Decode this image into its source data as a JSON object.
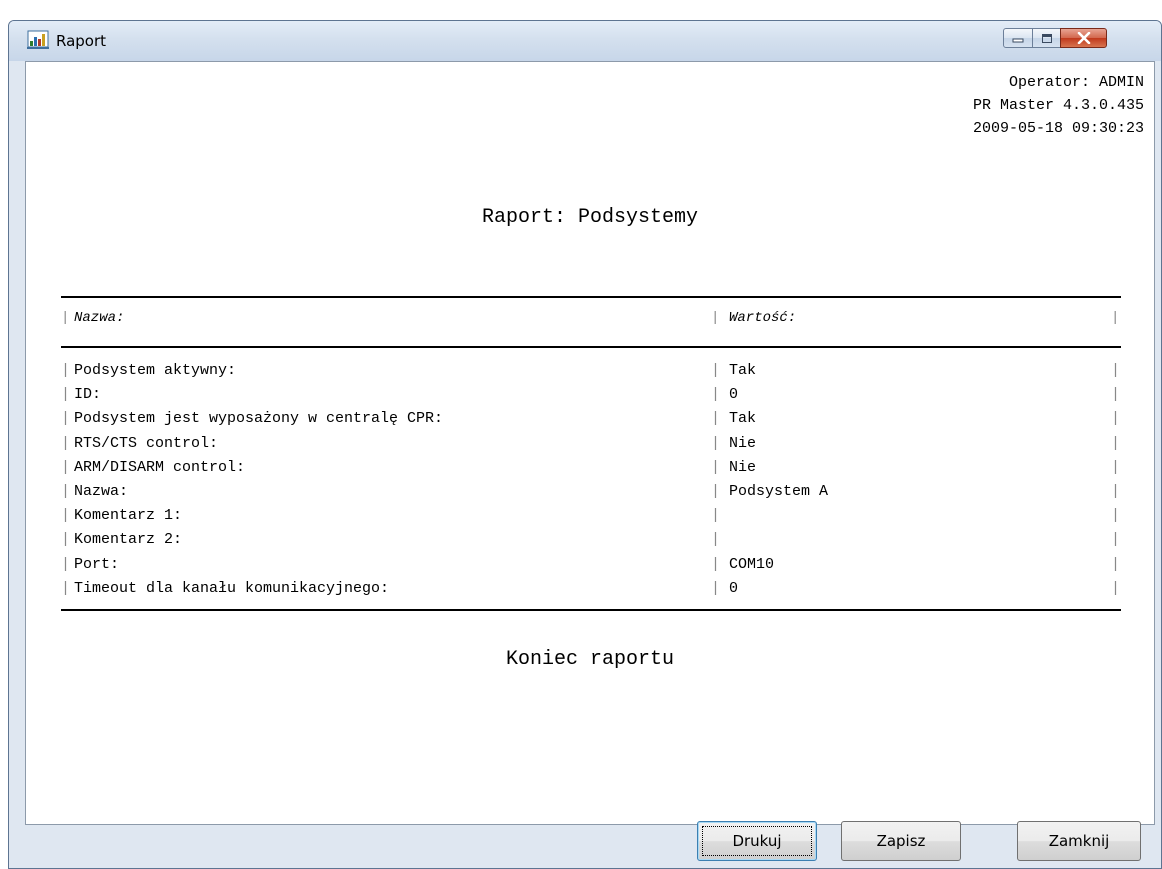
{
  "window": {
    "title": "Raport"
  },
  "report": {
    "operator": "Operator: ADMIN",
    "version": "PR Master 4.3.0.435",
    "datetime": "2009-05-18 09:30:23",
    "title": "Raport: Podsystemy",
    "columns": {
      "name": "Nazwa:",
      "value": "Wartość:"
    },
    "rows": [
      {
        "name": "Podsystem aktywny:",
        "value": "Tak"
      },
      {
        "name": "ID:",
        "value": "0"
      },
      {
        "name": "Podsystem jest wyposażony w centralę CPR:",
        "value": "Tak"
      },
      {
        "name": "RTS/CTS control:",
        "value": "Nie"
      },
      {
        "name": "ARM/DISARM control:",
        "value": "Nie"
      },
      {
        "name": "Nazwa:",
        "value": "Podsystem A"
      },
      {
        "name": "Komentarz 1:",
        "value": ""
      },
      {
        "name": "Komentarz 2:",
        "value": ""
      },
      {
        "name": "Port:",
        "value": "COM10"
      },
      {
        "name": "Timeout dla kanału komunikacyjnego:",
        "value": "0"
      }
    ],
    "end_text": "Koniec raportu"
  },
  "buttons": {
    "print": "Drukuj",
    "save": "Zapisz",
    "close": "Zamknij"
  },
  "icons": {
    "app": "report-app-icon",
    "minimize": "minimize-icon",
    "maximize": "maximize-icon",
    "close": "close-icon"
  }
}
